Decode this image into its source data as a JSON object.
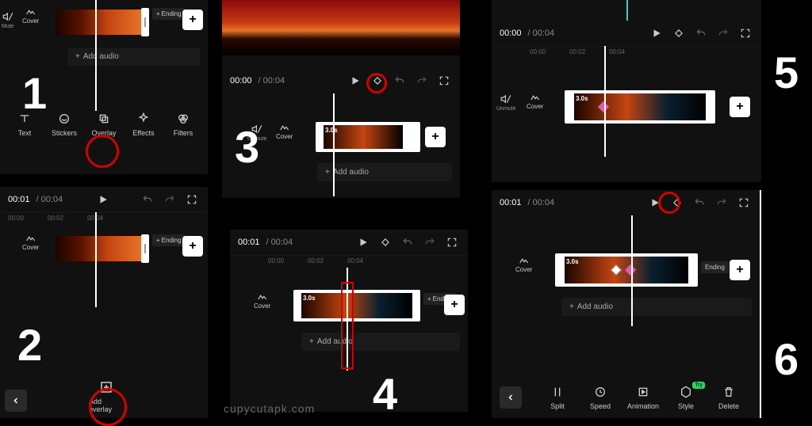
{
  "steps": [
    "1",
    "2",
    "3",
    "4",
    "5",
    "6"
  ],
  "time": {
    "t0000": "00:00",
    "t0001": "00:01",
    "dur": "/ 00:04"
  },
  "ruler": [
    "00:00",
    "00:02",
    "00:04"
  ],
  "labels": {
    "mute": "Mute",
    "unmute": "Unmute",
    "cover": "Cover",
    "ending": "Ending",
    "add_audio": "Add audio",
    "add_overlay": "Add overlay",
    "clip_dur": "3.0s"
  },
  "tools_p1": [
    {
      "name": "text",
      "label": "Text"
    },
    {
      "name": "stickers",
      "label": "Stickers"
    },
    {
      "name": "overlay",
      "label": "Overlay"
    },
    {
      "name": "effects",
      "label": "Effects"
    },
    {
      "name": "filters",
      "label": "Filters"
    }
  ],
  "tools_p6": [
    {
      "name": "split",
      "label": "Split"
    },
    {
      "name": "speed",
      "label": "Speed"
    },
    {
      "name": "animation",
      "label": "Animation"
    },
    {
      "name": "style",
      "label": "Style",
      "badge": "Try"
    },
    {
      "name": "delete",
      "label": "Delete"
    }
  ],
  "watermark": "cupycutapk.com"
}
